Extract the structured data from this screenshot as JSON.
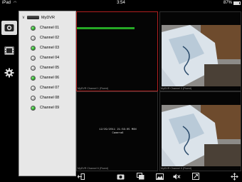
{
  "status_bar": {
    "carrier": "iPad",
    "time": "3:54",
    "battery_percent": "87%",
    "battery_level": 0.87,
    "wifi_icon": "wifi-icon"
  },
  "toolbar": {
    "items": [
      {
        "name": "live-view",
        "icon": "camera-icon",
        "active": true
      },
      {
        "name": "playback",
        "icon": "film-icon",
        "active": false
      },
      {
        "name": "settings",
        "icon": "gear-icon",
        "active": false
      }
    ]
  },
  "device_list": {
    "device_name": "MyDVR",
    "channels": [
      {
        "label": "Channel 01",
        "online": true
      },
      {
        "label": "Channel 02",
        "online": false
      },
      {
        "label": "Channel 03",
        "online": true
      },
      {
        "label": "Channel 04",
        "online": false
      },
      {
        "label": "Channel 05",
        "online": false
      },
      {
        "label": "Channel 06",
        "online": true
      },
      {
        "label": "Channel 07",
        "online": false
      },
      {
        "label": "Channel 08",
        "online": false
      },
      {
        "label": "Channel 09",
        "online": true
      }
    ]
  },
  "video_grid": {
    "cells": [
      {
        "caption": "MyDVR Channel 1 (Fluent)",
        "selected": true,
        "content": "loading"
      },
      {
        "caption": "MyDVR Channel 3 (Fluent)",
        "selected": false,
        "content": "camera"
      },
      {
        "caption": "MyDVR Channel 6 (Fluent)",
        "selected": false,
        "content": "osd"
      },
      {
        "caption": "MyDVR Channel 9 (Fluent)",
        "selected": false,
        "content": "camera"
      }
    ],
    "osd_line1": "12/29/2011 21:56:05 MON",
    "osd_line2": "Camera6",
    "loading_progress": 0.7
  },
  "controls": {
    "items": [
      "exit-icon",
      "snapshot-icon",
      "record-icon",
      "gallery-icon",
      "mute-icon",
      "fullscreen-icon",
      "ptz-icon"
    ]
  },
  "colors": {
    "online": "#1c9e1a",
    "selected_border": "#b02020",
    "list_bg": "#e7e7e7"
  }
}
